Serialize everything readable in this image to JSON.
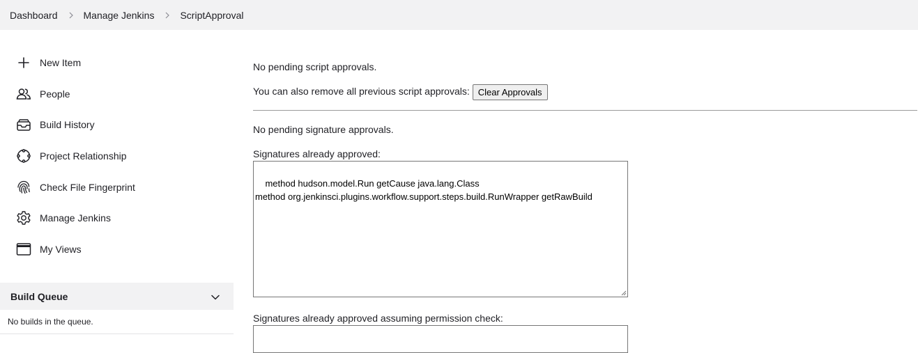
{
  "breadcrumb": {
    "items": [
      "Dashboard",
      "Manage Jenkins",
      "ScriptApproval"
    ]
  },
  "sidebar": {
    "tasks": [
      {
        "label": "New Item",
        "icon": "plus-icon"
      },
      {
        "label": "People",
        "icon": "people-icon"
      },
      {
        "label": "Build History",
        "icon": "inbox-icon"
      },
      {
        "label": "Project Relationship",
        "icon": "relationship-icon"
      },
      {
        "label": "Check File Fingerprint",
        "icon": "fingerprint-icon"
      },
      {
        "label": "Manage Jenkins",
        "icon": "gear-icon"
      },
      {
        "label": "My Views",
        "icon": "window-icon"
      }
    ],
    "build_queue": {
      "title": "Build Queue",
      "empty_text": "No builds in the queue."
    }
  },
  "main": {
    "no_pending_script": "No pending script approvals.",
    "remove_all_text": "You can also remove all previous script approvals:",
    "clear_button": "Clear Approvals",
    "no_pending_signature": "No pending signature approvals.",
    "approved_label": "Signatures already approved:",
    "approved_signatures": "method hudson.model.Run getCause java.lang.Class\nmethod org.jenkinsci.plugins.workflow.support.steps.build.RunWrapper getRawBuild",
    "approved_perm_label": "Signatures already approved assuming permission check:",
    "approved_perm_signatures": ""
  },
  "colors": {
    "breadcrumb_bg": "#f2f2f3",
    "text": "#1f1f24",
    "divider": "#9a9a9a"
  }
}
